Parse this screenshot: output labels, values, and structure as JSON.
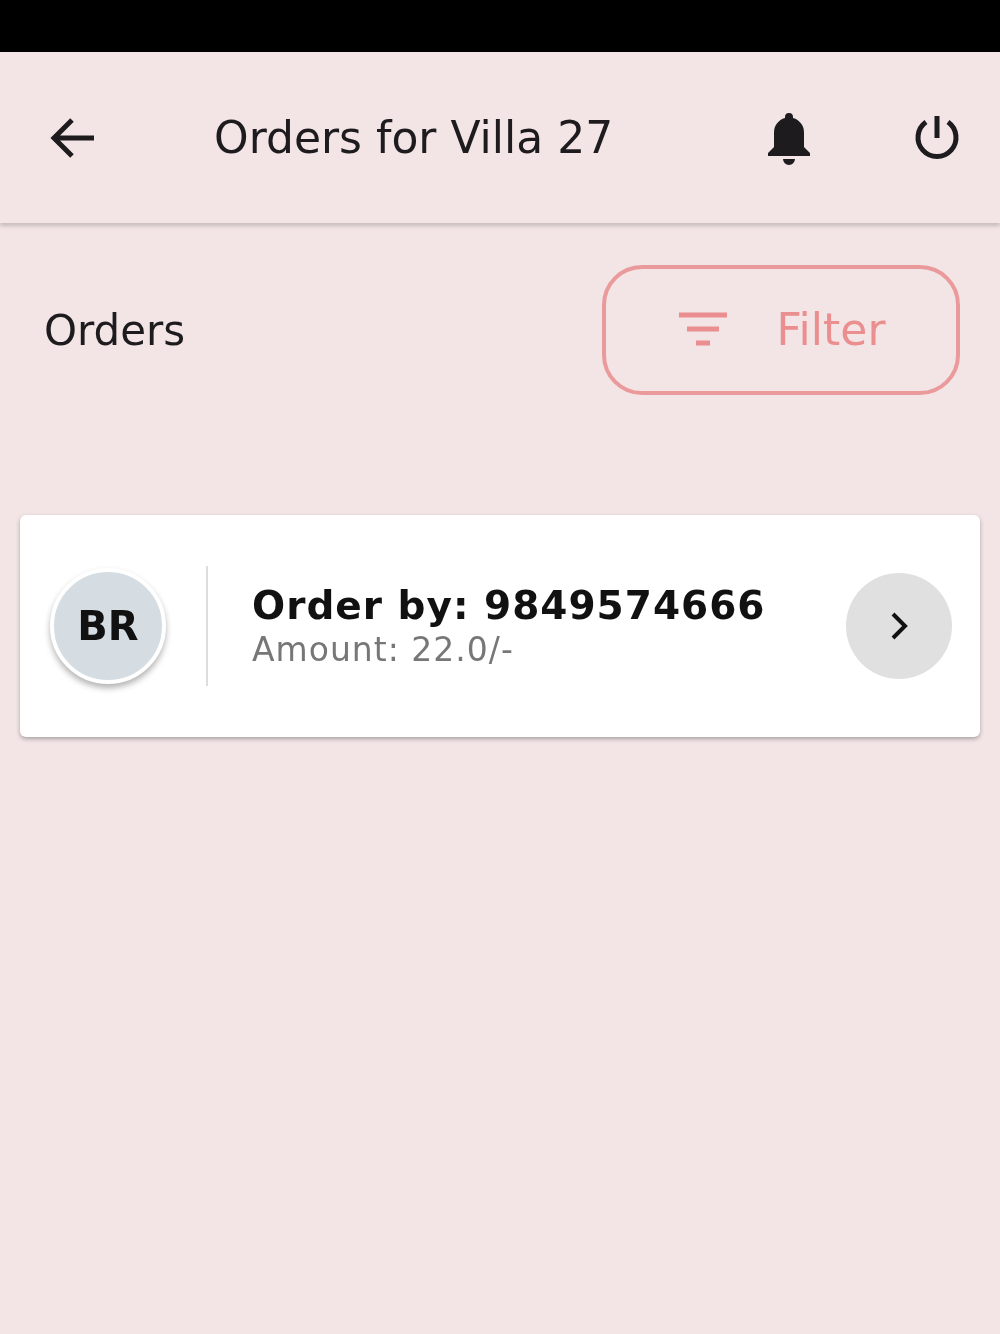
{
  "app_bar": {
    "title": "Orders for Villa 27"
  },
  "section": {
    "title": "Orders"
  },
  "filter_button": {
    "label": "Filter"
  },
  "orders": [
    {
      "initials": "BR",
      "order_by": "Order by: 9849574666",
      "amount": "Amount: 22.0/-"
    }
  ]
}
